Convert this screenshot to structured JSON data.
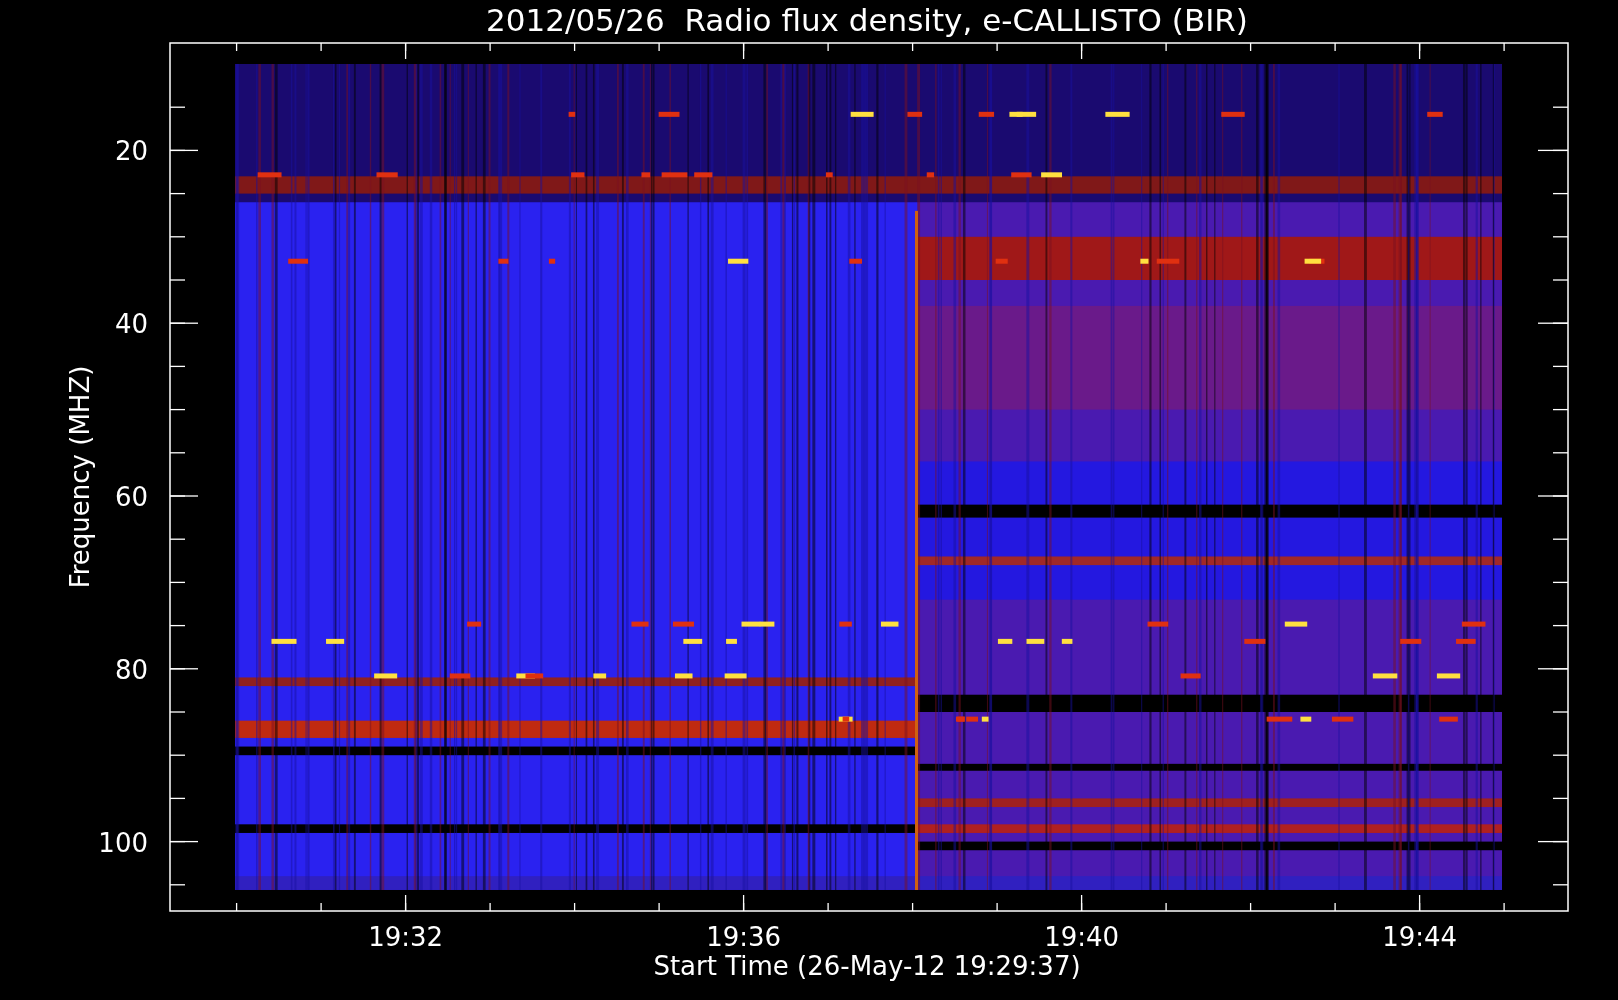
{
  "chart": {
    "title": "2012/05/26  Radio flux density, e-CALLISTO (BIR)",
    "ylabel": "Frequency (MHZ)",
    "xlabel": "Start Time (26-May-12 19:29:37)",
    "yticks": [
      "20",
      "40",
      "60",
      "80",
      "100"
    ],
    "xticks": [
      "19:32",
      "19:36",
      "19:40",
      "19:44"
    ]
  }
}
